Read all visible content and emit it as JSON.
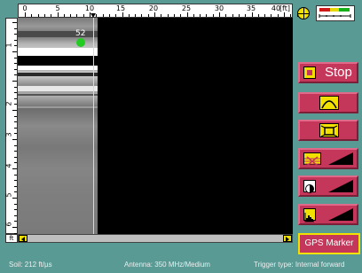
{
  "ruler_top": {
    "labels": [
      "0",
      "5",
      "10",
      "15",
      "20",
      "25",
      "30",
      "35",
      "40"
    ],
    "unit": "[ft]"
  },
  "ruler_left": {
    "labels": [
      "1",
      "2",
      "3",
      "4",
      "5",
      "6"
    ]
  },
  "scan": {
    "trace_value": "52"
  },
  "scroll": {
    "unit_box": "ft"
  },
  "buttons": {
    "stop_label": "Stop",
    "gps_marker_label": "GPS Marker"
  },
  "status": {
    "soil": "Soil:  212 ft/µs",
    "antenna": "Antenna: 350 MHz/Medium",
    "trigger": "Trigger type: Internal forward"
  },
  "icons": {
    "crosshair": "crosshair-icon",
    "gain": "gain-indicator-icon",
    "stop": "stop-square-icon",
    "wave": "hyperbola-icon",
    "zoom": "fit-window-icon",
    "filter": "background-filter-icon",
    "contrast": "contrast-icon",
    "colormap": "histogram-icon"
  },
  "colors": {
    "background": "#5a9a95",
    "button": "#c4365a",
    "accent": "#f2e000",
    "gps_dot": "#22cc22"
  }
}
